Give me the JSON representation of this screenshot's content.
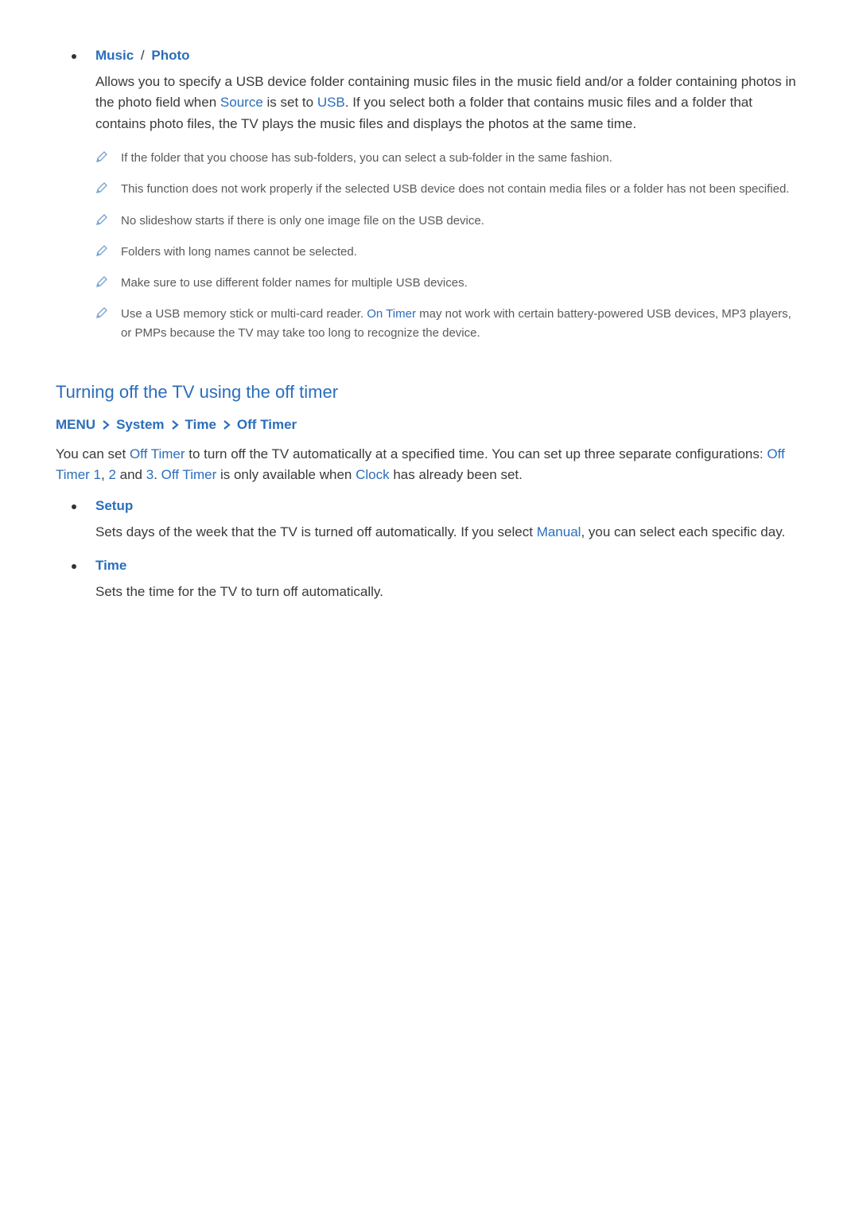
{
  "section1": {
    "bullet1": {
      "title_music": "Music",
      "slash": " / ",
      "title_photo": "Photo",
      "body_pre": "Allows you to specify a USB device folder containing music files in the music field and/or a folder containing photos in the photo field when ",
      "body_source": "Source",
      "body_mid1": " is set to ",
      "body_usb": "USB",
      "body_post": ". If you select both a folder that contains music files and a folder that contains photo files, the TV plays the music files and displays the photos at the same time."
    },
    "notes": {
      "n1": "If the folder that you choose has sub-folders, you can select a sub-folder in the same fashion.",
      "n2": "This function does not work properly if the selected USB device does not contain media files or a folder has not been specified.",
      "n3": "No slideshow starts if there is only one image file on the USB device.",
      "n4": "Folders with long names cannot be selected.",
      "n5": "Make sure to use different folder names for multiple USB devices.",
      "n6_pre": "Use a USB memory stick or multi-card reader. ",
      "n6_hl": "On Timer",
      "n6_post": " may not work with certain battery-powered USB devices, MP3 players, or PMPs because the TV may take too long to recognize the device."
    }
  },
  "section2": {
    "heading": "Turning off the TV using the off timer",
    "breadcrumb": {
      "b1": "MENU",
      "b2": "System",
      "b3": "Time",
      "b4": "Off Timer"
    },
    "para": {
      "p1": "You can set ",
      "p1_hl1": "Off Timer",
      "p2": " to turn off the TV automatically at a specified time. You can set up three separate configurations: ",
      "p2_hl1": "Off Timer 1",
      "p2_c1": ", ",
      "p2_hl2": "2",
      "p2_c2": " and ",
      "p2_hl3": "3",
      "p2_c3": ". ",
      "p2_hl4": "Off Timer",
      "p2_c4": " is only available when ",
      "p2_hl5": "Clock",
      "p2_c5": " has already been set."
    },
    "setup": {
      "title": "Setup",
      "body_pre": "Sets days of the week that the TV is turned off automatically. If you select ",
      "body_hl": "Manual",
      "body_post": ", you can select each specific day."
    },
    "time": {
      "title": "Time",
      "body": "Sets the time for the TV to turn off automatically."
    }
  }
}
